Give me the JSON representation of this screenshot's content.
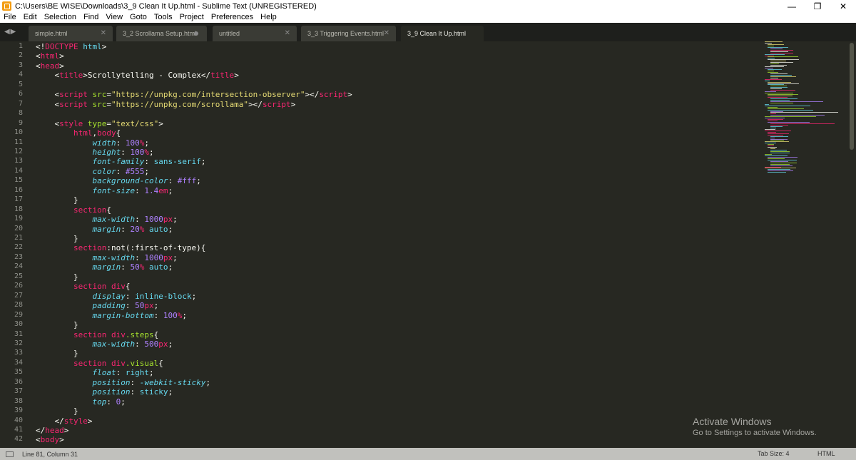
{
  "window": {
    "title": "C:\\Users\\BE WISE\\Downloads\\3_9 Clean It Up.html - Sublime Text (UNREGISTERED)",
    "controls": {
      "minimize": "—",
      "restore": "❐",
      "close": "✕"
    }
  },
  "menu": [
    "File",
    "Edit",
    "Selection",
    "Find",
    "View",
    "Goto",
    "Tools",
    "Project",
    "Preferences",
    "Help"
  ],
  "nav_arrows": "◀ ▶",
  "tabs": [
    {
      "label": "simple.html",
      "indicator": "close"
    },
    {
      "label": "3_2 Scrollama Setup.html",
      "indicator": "dirty"
    },
    {
      "label": "untitled",
      "indicator": "close"
    },
    {
      "label": "3_3 Triggering Events.html",
      "indicator": "close"
    },
    {
      "label": "3_9 Clean It Up.html",
      "indicator": "close",
      "active": true
    }
  ],
  "tab_close_glyph": "✕",
  "colors": {
    "text": "#f8f8f2",
    "keyword": "#f92672",
    "string": "#e6db74",
    "constant": "#ae81ff",
    "property": "#66d9ef",
    "selector": "#a6e22e",
    "background": "#272822"
  },
  "code_lines": [
    [
      [
        "<!",
        "text"
      ],
      [
        "DOCTYPE",
        "keyword"
      ],
      [
        " ",
        "text"
      ],
      [
        "html",
        "property"
      ],
      [
        ">",
        "text"
      ]
    ],
    [
      [
        "<",
        "text"
      ],
      [
        "html",
        "keyword"
      ],
      [
        ">",
        "text"
      ]
    ],
    [
      [
        "<",
        "text"
      ],
      [
        "head",
        "keyword"
      ],
      [
        ">",
        "text"
      ]
    ],
    [
      [
        "    <",
        "text"
      ],
      [
        "title",
        "keyword"
      ],
      [
        ">Scrollytelling - Complex</",
        "text"
      ],
      [
        "title",
        "keyword"
      ],
      [
        ">",
        "text"
      ]
    ],
    [],
    [
      [
        "    <",
        "text"
      ],
      [
        "script",
        "keyword"
      ],
      [
        " ",
        "text"
      ],
      [
        "src",
        "selector"
      ],
      [
        "=",
        "text"
      ],
      [
        "\"https://unpkg.com/intersection-observer\"",
        "string"
      ],
      [
        "></",
        "text"
      ],
      [
        "script",
        "keyword"
      ],
      [
        ">",
        "text"
      ]
    ],
    [
      [
        "    <",
        "text"
      ],
      [
        "script",
        "keyword"
      ],
      [
        " ",
        "text"
      ],
      [
        "src",
        "selector"
      ],
      [
        "=",
        "text"
      ],
      [
        "\"https://unpkg.com/scrollama\"",
        "string"
      ],
      [
        "></",
        "text"
      ],
      [
        "script",
        "keyword"
      ],
      [
        ">",
        "text"
      ]
    ],
    [],
    [
      [
        "    <",
        "text"
      ],
      [
        "style",
        "keyword"
      ],
      [
        " ",
        "text"
      ],
      [
        "type",
        "selector"
      ],
      [
        "=",
        "text"
      ],
      [
        "\"text/css\"",
        "string"
      ],
      [
        ">",
        "text"
      ]
    ],
    [
      [
        "        ",
        "text"
      ],
      [
        "html",
        "keyword"
      ],
      [
        ",",
        "text"
      ],
      [
        "body",
        "keyword"
      ],
      [
        "{",
        "text"
      ]
    ],
    [
      [
        "            ",
        "text"
      ],
      [
        "width",
        "property-italic"
      ],
      [
        ": ",
        "text"
      ],
      [
        "100",
        "constant"
      ],
      [
        "%",
        "keyword"
      ],
      [
        ";",
        "text"
      ]
    ],
    [
      [
        "            ",
        "text"
      ],
      [
        "height",
        "property-italic"
      ],
      [
        ": ",
        "text"
      ],
      [
        "100",
        "constant"
      ],
      [
        "%",
        "keyword"
      ],
      [
        ";",
        "text"
      ]
    ],
    [
      [
        "            ",
        "text"
      ],
      [
        "font-family",
        "property-italic"
      ],
      [
        ": ",
        "text"
      ],
      [
        "sans-serif",
        "property"
      ],
      [
        ";",
        "text"
      ]
    ],
    [
      [
        "            ",
        "text"
      ],
      [
        "color",
        "property-italic"
      ],
      [
        ": ",
        "text"
      ],
      [
        "#555",
        "constant"
      ],
      [
        ";",
        "text"
      ]
    ],
    [
      [
        "            ",
        "text"
      ],
      [
        "background-color",
        "property-italic"
      ],
      [
        ": ",
        "text"
      ],
      [
        "#fff",
        "constant"
      ],
      [
        ";",
        "text"
      ]
    ],
    [
      [
        "            ",
        "text"
      ],
      [
        "font-size",
        "property-italic"
      ],
      [
        ": ",
        "text"
      ],
      [
        "1.4",
        "constant"
      ],
      [
        "em",
        "keyword"
      ],
      [
        ";",
        "text"
      ]
    ],
    [
      [
        "        }",
        "text"
      ]
    ],
    [
      [
        "        ",
        "text"
      ],
      [
        "section",
        "keyword"
      ],
      [
        "{",
        "text"
      ]
    ],
    [
      [
        "            ",
        "text"
      ],
      [
        "max-width",
        "property-italic"
      ],
      [
        ": ",
        "text"
      ],
      [
        "1000",
        "constant"
      ],
      [
        "px",
        "keyword"
      ],
      [
        ";",
        "text"
      ]
    ],
    [
      [
        "            ",
        "text"
      ],
      [
        "margin",
        "property-italic"
      ],
      [
        ": ",
        "text"
      ],
      [
        "20",
        "constant"
      ],
      [
        "%",
        "keyword"
      ],
      [
        " ",
        "text"
      ],
      [
        "auto",
        "property"
      ],
      [
        ";",
        "text"
      ]
    ],
    [
      [
        "        }",
        "text"
      ]
    ],
    [
      [
        "        ",
        "text"
      ],
      [
        "section",
        "keyword"
      ],
      [
        ":not(:first-of-type){",
        "text"
      ]
    ],
    [
      [
        "            ",
        "text"
      ],
      [
        "max-width",
        "property-italic"
      ],
      [
        ": ",
        "text"
      ],
      [
        "1000",
        "constant"
      ],
      [
        "px",
        "keyword"
      ],
      [
        ";",
        "text"
      ]
    ],
    [
      [
        "            ",
        "text"
      ],
      [
        "margin",
        "property-italic"
      ],
      [
        ": ",
        "text"
      ],
      [
        "50",
        "constant"
      ],
      [
        "%",
        "keyword"
      ],
      [
        " ",
        "text"
      ],
      [
        "auto",
        "property"
      ],
      [
        ";",
        "text"
      ]
    ],
    [
      [
        "        }",
        "text"
      ]
    ],
    [
      [
        "        ",
        "text"
      ],
      [
        "section div",
        "keyword"
      ],
      [
        "{",
        "text"
      ]
    ],
    [
      [
        "            ",
        "text"
      ],
      [
        "display",
        "property-italic"
      ],
      [
        ": ",
        "text"
      ],
      [
        "inline-block",
        "property"
      ],
      [
        ";",
        "text"
      ]
    ],
    [
      [
        "            ",
        "text"
      ],
      [
        "padding",
        "property-italic"
      ],
      [
        ": ",
        "text"
      ],
      [
        "50",
        "constant"
      ],
      [
        "px",
        "keyword"
      ],
      [
        ";",
        "text"
      ]
    ],
    [
      [
        "            ",
        "text"
      ],
      [
        "margin-bottom",
        "property-italic"
      ],
      [
        ": ",
        "text"
      ],
      [
        "100",
        "constant"
      ],
      [
        "%",
        "keyword"
      ],
      [
        ";",
        "text"
      ]
    ],
    [
      [
        "        }",
        "text"
      ]
    ],
    [
      [
        "        ",
        "text"
      ],
      [
        "section div",
        "keyword"
      ],
      [
        ".steps",
        "selector"
      ],
      [
        "{",
        "text"
      ]
    ],
    [
      [
        "            ",
        "text"
      ],
      [
        "max-width",
        "property-italic"
      ],
      [
        ": ",
        "text"
      ],
      [
        "500",
        "constant"
      ],
      [
        "px",
        "keyword"
      ],
      [
        ";",
        "text"
      ]
    ],
    [
      [
        "        }",
        "text"
      ]
    ],
    [
      [
        "        ",
        "text"
      ],
      [
        "section div",
        "keyword"
      ],
      [
        ".visual",
        "selector"
      ],
      [
        "{",
        "text"
      ]
    ],
    [
      [
        "            ",
        "text"
      ],
      [
        "float",
        "property-italic"
      ],
      [
        ": ",
        "text"
      ],
      [
        "right",
        "property"
      ],
      [
        ";",
        "text"
      ]
    ],
    [
      [
        "            ",
        "text"
      ],
      [
        "position",
        "property-italic"
      ],
      [
        ": ",
        "text"
      ],
      [
        "-webkit-sticky",
        "property-italic"
      ],
      [
        ";",
        "text"
      ]
    ],
    [
      [
        "            ",
        "text"
      ],
      [
        "position",
        "property-italic"
      ],
      [
        ": ",
        "text"
      ],
      [
        "sticky",
        "property"
      ],
      [
        ";",
        "text"
      ]
    ],
    [
      [
        "            ",
        "text"
      ],
      [
        "top",
        "property-italic"
      ],
      [
        ": ",
        "text"
      ],
      [
        "0",
        "constant"
      ],
      [
        ";",
        "text"
      ]
    ],
    [
      [
        "        }",
        "text"
      ]
    ],
    [
      [
        "    </",
        "text"
      ],
      [
        "style",
        "keyword"
      ],
      [
        ">",
        "text"
      ]
    ],
    [
      [
        "</",
        "text"
      ],
      [
        "head",
        "keyword"
      ],
      [
        ">",
        "text"
      ]
    ],
    [
      [
        "<",
        "text"
      ],
      [
        "body",
        "keyword"
      ],
      [
        ">",
        "text"
      ]
    ]
  ],
  "watermark": {
    "title": "Activate Windows",
    "subtitle": "Go to Settings to activate Windows."
  },
  "status": {
    "cursor": "Line 81, Column 31",
    "tab_size": "Tab Size: 4",
    "syntax": "HTML"
  }
}
